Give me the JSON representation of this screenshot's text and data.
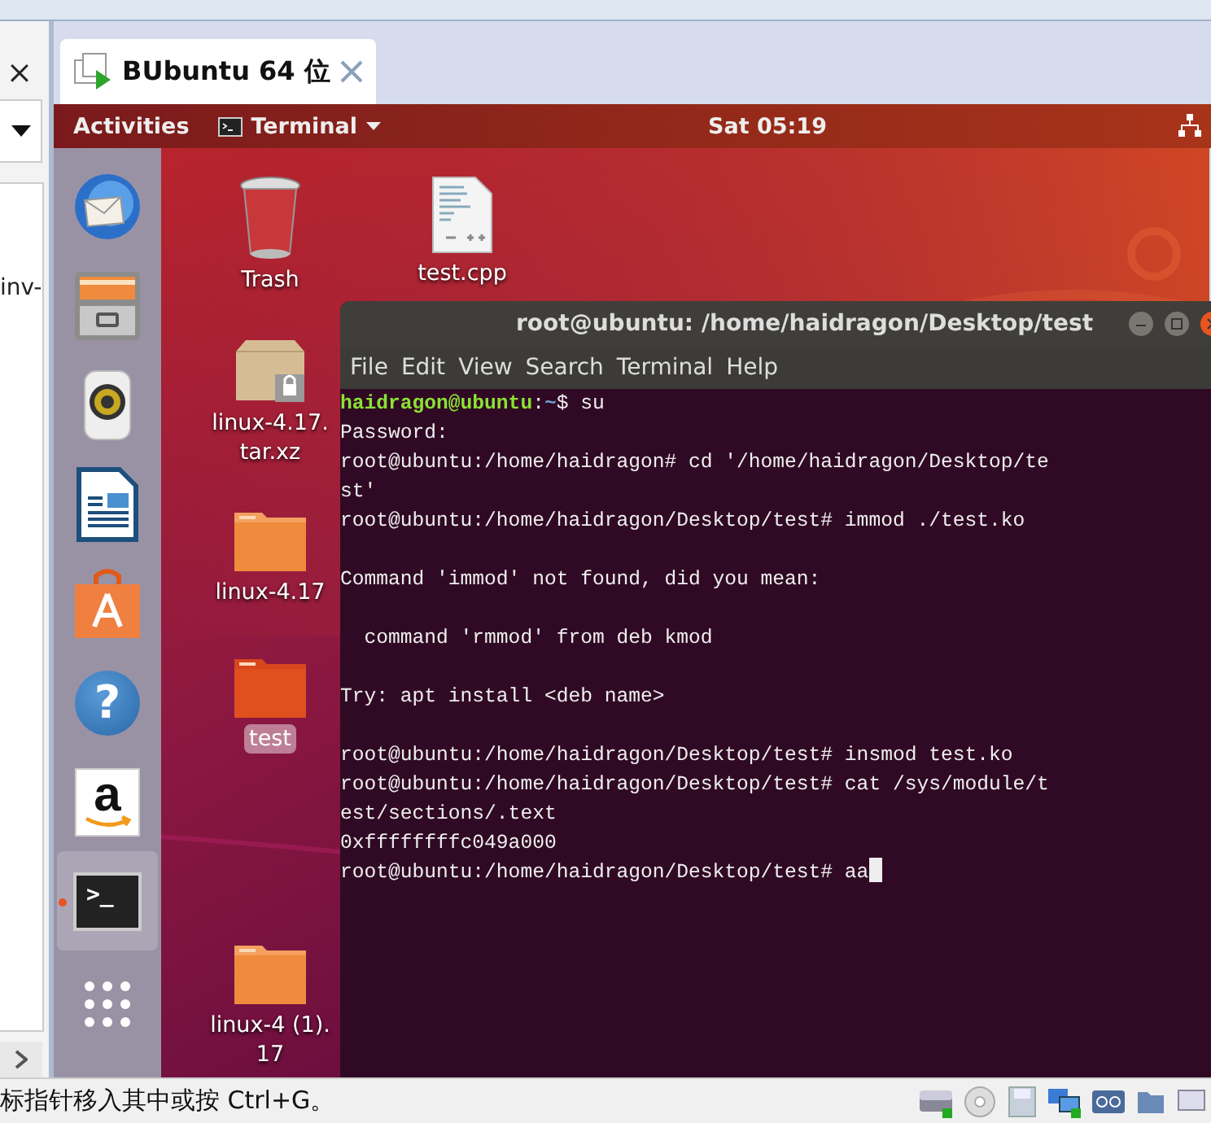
{
  "left_panel": {
    "text": "inv-"
  },
  "tab": {
    "title": "BUbuntu 64 位",
    "selected": true
  },
  "top_bar": {
    "activities": "Activities",
    "app_menu": "Terminal",
    "clock": "Sat 05:19"
  },
  "dock": [
    {
      "kind": "mail",
      "running": false
    },
    {
      "kind": "files",
      "running": false
    },
    {
      "kind": "speaker",
      "running": false
    },
    {
      "kind": "writer",
      "running": false
    },
    {
      "kind": "store",
      "running": false
    },
    {
      "kind": "help",
      "glyph": "?",
      "running": false
    },
    {
      "kind": "amazon",
      "glyph": "a",
      "running": false
    },
    {
      "kind": "terminal",
      "glyph": ">_",
      "running": true
    },
    {
      "kind": "apps"
    }
  ],
  "desktop_icons": [
    {
      "kind": "trash",
      "label_lines": [
        "Trash"
      ],
      "selected": false
    },
    {
      "kind": "cpp",
      "label_lines": [
        "test.cpp"
      ],
      "selected": false
    },
    {
      "kind": "archive",
      "label_lines": [
        "linux-4.17.",
        "tar.xz"
      ],
      "selected": false
    },
    {
      "kind": "folder",
      "label_lines": [
        "linux-4.17"
      ],
      "selected": false
    },
    {
      "kind": "folder_red",
      "label_lines": [
        "test"
      ],
      "selected": true
    },
    {
      "kind": "folder",
      "label_lines": [
        "linux-4 (1).",
        "17"
      ],
      "selected": false
    }
  ],
  "terminal": {
    "title": "root@ubuntu: /home/haidragon/Desktop/test",
    "menu": [
      "File",
      "Edit",
      "View",
      "Search",
      "Terminal",
      "Help"
    ],
    "lines": [
      {
        "kind": "prompt",
        "user": "haidragon@ubuntu",
        "sep": ":",
        "path": "~",
        "text": "$ su"
      },
      {
        "kind": "output",
        "text": "Password:"
      },
      {
        "kind": "output",
        "text": "root@ubuntu:/home/haidragon# cd '/home/haidragon/Desktop/te"
      },
      {
        "kind": "output",
        "text": "st'"
      },
      {
        "kind": "output",
        "text": "root@ubuntu:/home/haidragon/Desktop/test# immod ./test.ko"
      },
      {
        "kind": "blank"
      },
      {
        "kind": "output",
        "text": "Command 'immod' not found, did you mean:"
      },
      {
        "kind": "blank"
      },
      {
        "kind": "output",
        "text": "  command 'rmmod' from deb kmod"
      },
      {
        "kind": "blank"
      },
      {
        "kind": "output",
        "text": "Try: apt install <deb name>"
      },
      {
        "kind": "blank"
      },
      {
        "kind": "output",
        "text": "root@ubuntu:/home/haidragon/Desktop/test# insmod test.ko"
      },
      {
        "kind": "output",
        "text": "root@ubuntu:/home/haidragon/Desktop/test# cat /sys/module/t"
      },
      {
        "kind": "output",
        "text": "est/sections/.text"
      },
      {
        "kind": "output",
        "text": "0xffffffffc049a000"
      },
      {
        "kind": "output",
        "text": "root@ubuntu:/home/haidragon/Desktop/test# aa",
        "cursor": true
      }
    ]
  },
  "status_bar": {
    "text": "标指针移入其中或按 Ctrl+G。"
  }
}
